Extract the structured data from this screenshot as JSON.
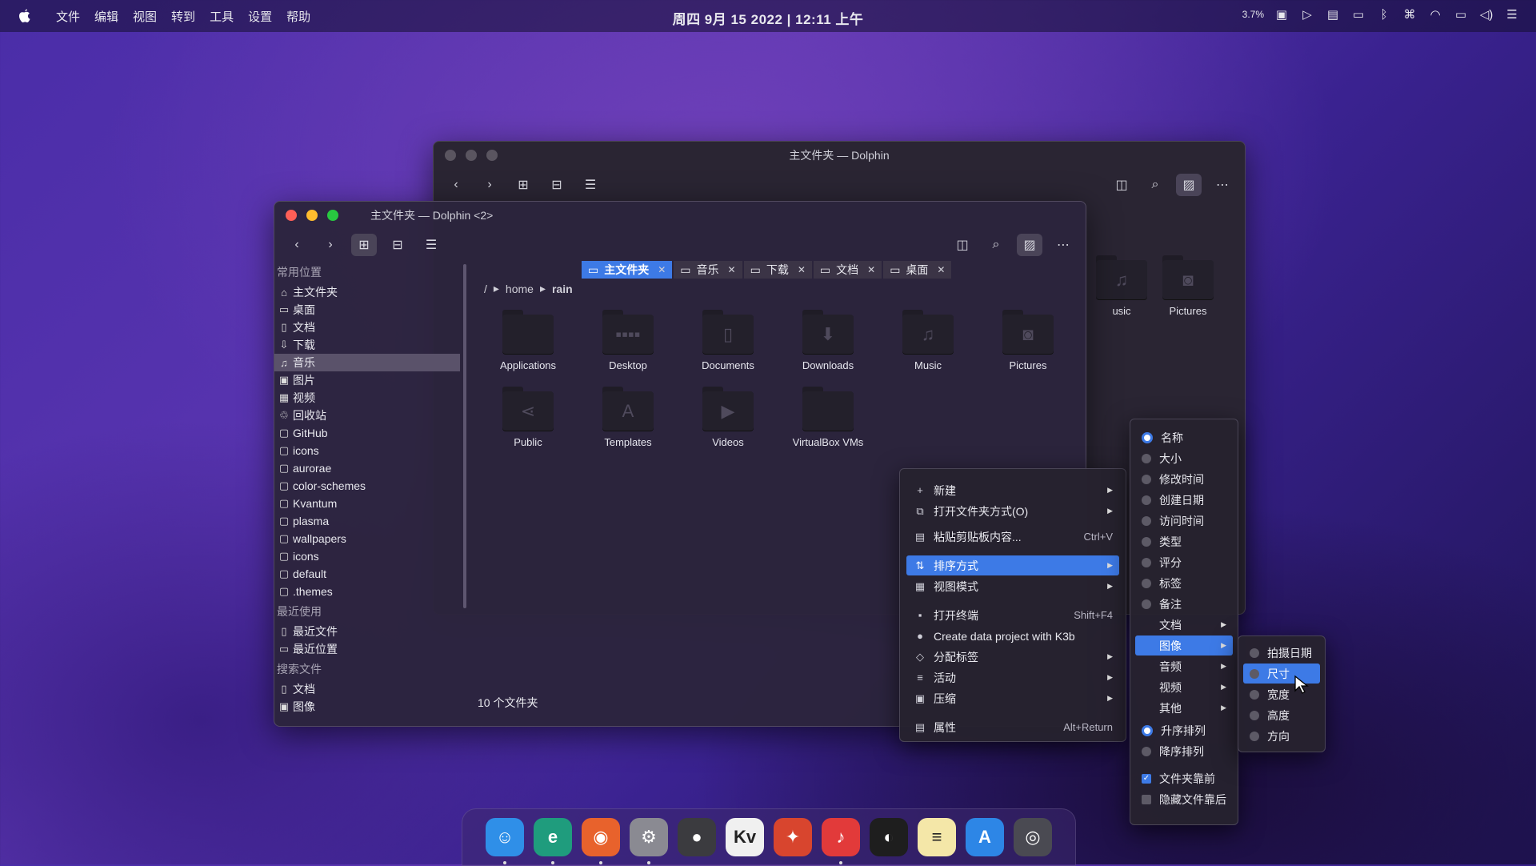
{
  "topbar": {
    "menus": [
      "文件",
      "编辑",
      "视图",
      "转到",
      "工具",
      "设置",
      "帮助"
    ],
    "clock": "周四 9月 15 2022 | 12:11 上午",
    "cpu": "3.7%",
    "icons": [
      "chat-icon",
      "play-icon",
      "clipboard-icon",
      "battery-icon",
      "bluetooth-icon",
      "command-icon",
      "wifi-icon",
      "display-icon",
      "volume-icon",
      "toggle-icon"
    ]
  },
  "back_window": {
    "title": "主文件夹 — Dolphin",
    "items": [
      {
        "label": "usic"
      },
      {
        "label": "Pictures"
      }
    ]
  },
  "front_window": {
    "title": "主文件夹 — Dolphin <2>",
    "sidebar": {
      "sections": [
        {
          "heading": "常用位置",
          "items": [
            {
              "label": "主文件夹",
              "icon": "⌂"
            },
            {
              "label": "桌面",
              "icon": "▭"
            },
            {
              "label": "文档",
              "icon": "▯"
            },
            {
              "label": "下载",
              "icon": "⇩"
            },
            {
              "label": "音乐",
              "icon": "♫",
              "selected": true
            },
            {
              "label": "图片",
              "icon": "▣"
            },
            {
              "label": "视频",
              "icon": "▦"
            },
            {
              "label": "回收站",
              "icon": "♲"
            },
            {
              "label": "GitHub",
              "icon": "▢"
            },
            {
              "label": "icons",
              "icon": "▢"
            },
            {
              "label": "aurorae",
              "icon": "▢"
            },
            {
              "label": "color-schemes",
              "icon": "▢"
            },
            {
              "label": "Kvantum",
              "icon": "▢"
            },
            {
              "label": "plasma",
              "icon": "▢"
            },
            {
              "label": "wallpapers",
              "icon": "▢"
            },
            {
              "label": "icons",
              "icon": "▢"
            },
            {
              "label": "default",
              "icon": "▢"
            },
            {
              "label": ".themes",
              "icon": "▢"
            }
          ]
        },
        {
          "heading": "最近使用",
          "items": [
            {
              "label": "最近文件",
              "icon": "▯"
            },
            {
              "label": "最近位置",
              "icon": "▭"
            }
          ]
        },
        {
          "heading": "搜索文件",
          "items": [
            {
              "label": "文档",
              "icon": "▯"
            },
            {
              "label": "图像",
              "icon": "▣"
            }
          ]
        }
      ]
    },
    "tabs": [
      {
        "label": "主文件夹",
        "active": true
      },
      {
        "label": "音乐"
      },
      {
        "label": "下载"
      },
      {
        "label": "文档"
      },
      {
        "label": "桌面"
      }
    ],
    "breadcrumb": {
      "root": "/",
      "parts": [
        "home",
        "rain"
      ]
    },
    "files": [
      {
        "label": "Applications",
        "glyph": ""
      },
      {
        "label": "Desktop",
        "glyph": "▪▪▪▪"
      },
      {
        "label": "Documents",
        "glyph": "▯"
      },
      {
        "label": "Downloads",
        "glyph": "⬇"
      },
      {
        "label": "Music",
        "glyph": "♫"
      },
      {
        "label": "Pictures",
        "glyph": "◙"
      },
      {
        "label": "Public",
        "glyph": "⋖"
      },
      {
        "label": "Templates",
        "glyph": "A"
      },
      {
        "label": "Videos",
        "glyph": "▶"
      },
      {
        "label": "VirtualBox VMs",
        "glyph": ""
      }
    ],
    "status": "10 个文件夹"
  },
  "context_menu": {
    "items": [
      {
        "label": "新建",
        "icon": "+",
        "submenu": true
      },
      {
        "label": "打开文件夹方式(O)",
        "icon": "⧉",
        "submenu": true
      },
      {
        "label": "粘贴剪贴板内容...",
        "icon": "▤",
        "shortcut": "Ctrl+V"
      },
      {
        "label": "排序方式",
        "icon": "⇅",
        "submenu": true,
        "highlight": true
      },
      {
        "label": "视图模式",
        "icon": "▦",
        "submenu": true
      },
      {
        "label": "打开终端",
        "icon": "▪",
        "shortcut": "Shift+F4"
      },
      {
        "label": "Create data project with K3b",
        "icon": "●"
      },
      {
        "label": "分配标签",
        "icon": "◇",
        "submenu": true
      },
      {
        "label": "活动",
        "icon": "≡",
        "submenu": true
      },
      {
        "label": "压缩",
        "icon": "▣",
        "submenu": true
      },
      {
        "label": "属性",
        "icon": "▤",
        "shortcut": "Alt+Return"
      }
    ]
  },
  "sort_menu": {
    "items": [
      {
        "label": "名称",
        "kind": "radio",
        "on": true
      },
      {
        "label": "大小",
        "kind": "radio"
      },
      {
        "label": "修改时间",
        "kind": "radio"
      },
      {
        "label": "创建日期",
        "kind": "radio"
      },
      {
        "label": "访问时间",
        "kind": "radio"
      },
      {
        "label": "类型",
        "kind": "radio"
      },
      {
        "label": "评分",
        "kind": "radio"
      },
      {
        "label": "标签",
        "kind": "radio"
      },
      {
        "label": "备注",
        "kind": "radio"
      },
      {
        "label": "文档",
        "kind": "sub"
      },
      {
        "label": "图像",
        "kind": "sub",
        "highlight": true
      },
      {
        "label": "音频",
        "kind": "sub"
      },
      {
        "label": "视频",
        "kind": "sub"
      },
      {
        "label": "其他",
        "kind": "sub"
      },
      {
        "label": "升序排列",
        "kind": "radio",
        "on": true
      },
      {
        "label": "降序排列",
        "kind": "radio"
      },
      {
        "label": "文件夹靠前",
        "kind": "check",
        "on": true
      },
      {
        "label": "隐藏文件靠后",
        "kind": "check"
      }
    ]
  },
  "image_submenu": {
    "items": [
      {
        "label": "拍摄日期"
      },
      {
        "label": "尺寸",
        "highlight": true
      },
      {
        "label": "宽度"
      },
      {
        "label": "高度"
      },
      {
        "label": "方向"
      }
    ]
  },
  "dock": {
    "apps": [
      {
        "name": "finder",
        "glyph": "☺",
        "bg": "#2f8fe8",
        "running": true
      },
      {
        "name": "edge-dev",
        "glyph": "e",
        "bg": "#1f9c7d",
        "running": true
      },
      {
        "name": "firefox",
        "glyph": "◉",
        "bg": "#e8622c",
        "running": true
      },
      {
        "name": "system-settings",
        "glyph": "⚙",
        "bg": "#8a8a92",
        "running": true
      },
      {
        "name": "github",
        "glyph": "●",
        "bg": "#3b3b3f",
        "running": false
      },
      {
        "name": "kvantum",
        "glyph": "Kv",
        "bg": "#f0f0f0",
        "running": false
      },
      {
        "name": "compass",
        "glyph": "✦",
        "bg": "#d8452e",
        "running": false
      },
      {
        "name": "netease-music",
        "glyph": "♪",
        "bg": "#e23a3a",
        "running": true
      },
      {
        "name": "figma",
        "glyph": "◐",
        "bg": "#1e1e1e",
        "running": false
      },
      {
        "name": "notes",
        "glyph": "≡",
        "bg": "#f4e7a8",
        "running": false
      },
      {
        "name": "app-store",
        "glyph": "A",
        "bg": "#2d86e6",
        "running": false
      },
      {
        "name": "screenshot",
        "glyph": "◎",
        "bg": "#4a4a52",
        "running": false
      }
    ]
  },
  "colors": {
    "accent": "#3d7ae6",
    "close": "#ff5f57",
    "min": "#febc2e",
    "max": "#28c840"
  }
}
